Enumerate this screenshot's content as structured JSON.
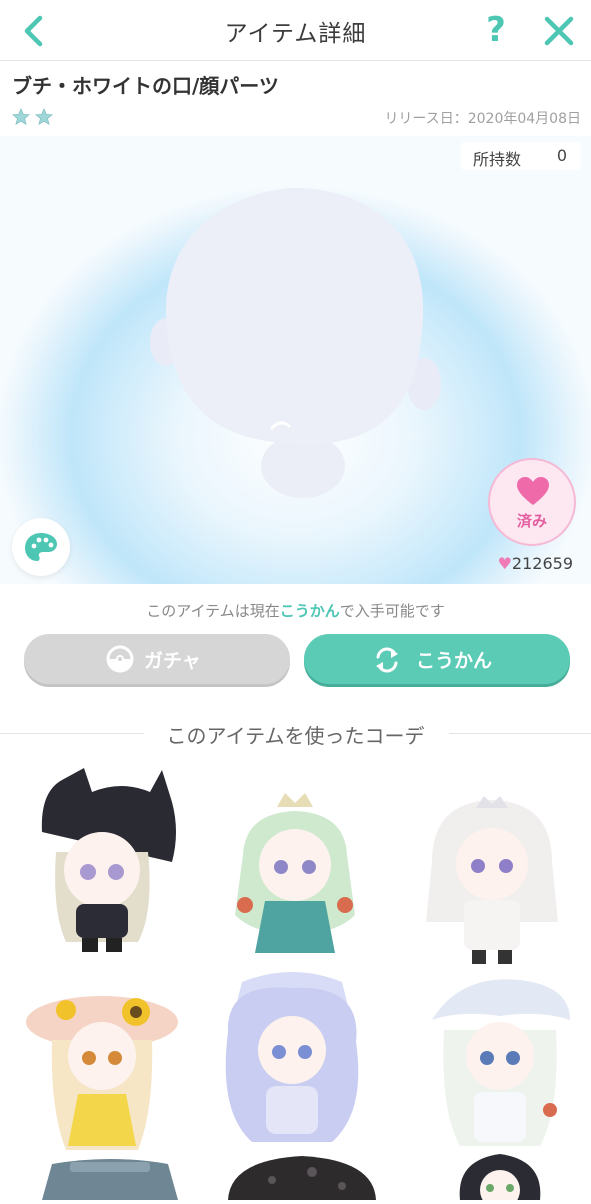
{
  "header": {
    "title": "アイテム詳細",
    "back_icon": "chevron-left-icon",
    "help_label": "?",
    "close_icon": "close-icon",
    "accent": "#4dc6b4"
  },
  "item": {
    "name": "ブチ・ホワイトの口/顔パーツ",
    "rarity_stars": 2,
    "release": "リリース日：2020年04月08日"
  },
  "preview": {
    "owned_label": "所持数",
    "owned_value": "0",
    "like_label": "済み",
    "like_count": "212659"
  },
  "availability": {
    "prefix": "このアイテムは現在",
    "highlight": "こうかん",
    "suffix": "で入手可能です"
  },
  "actions": {
    "gacha_label": "ガチャ",
    "koukan_label": "こうかん",
    "gacha_color": "#d6d6d6",
    "koukan_color": "#5ccbb5"
  },
  "coords": {
    "heading": "このアイテムを使ったコーデ"
  }
}
